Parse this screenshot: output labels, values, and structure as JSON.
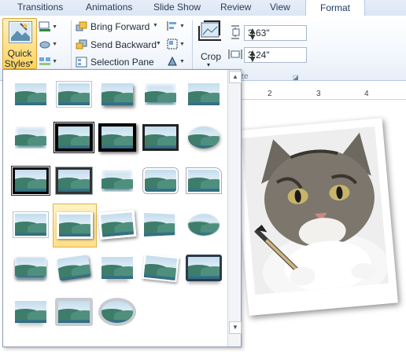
{
  "tabs": [
    {
      "label": "Transitions",
      "active": false
    },
    {
      "label": "Animations",
      "active": false
    },
    {
      "label": "Slide Show",
      "active": false
    },
    {
      "label": "Review",
      "active": false
    },
    {
      "label": "View",
      "active": false
    },
    {
      "label": "Format",
      "active": true
    }
  ],
  "ribbon": {
    "quick_styles": {
      "line1": "Quick",
      "line2": "Styles",
      "dropdown": "▾"
    },
    "arrange": {
      "bring_forward": "Bring Forward",
      "send_backward": "Send Backward",
      "selection_pane": "Selection Pane"
    },
    "crop": {
      "label": "Crop",
      "dropdown": "▾"
    },
    "size": {
      "height": "3.63\"",
      "width": "3.24\"",
      "group_label_fragment": "ze"
    }
  },
  "ruler": {
    "labels": [
      "2",
      "3",
      "4"
    ]
  },
  "gallery": {
    "icon": "picture-thumbnail-icon",
    "selected_index": 16,
    "styles": [
      "plain",
      "white",
      "shadow",
      "soft",
      "reflect-soft",
      "soft",
      "thickblack",
      "blackshadow",
      "darkframe",
      "oval",
      "blackdbl",
      "metal",
      "soft",
      "round",
      "snip",
      "white",
      "polaroid",
      "rotwhite",
      "persp",
      "feather",
      "bevel",
      "tilt",
      "reflect",
      "tiltwhite",
      "darkbevel",
      "lightreflect",
      "grayframe",
      "ovalframe"
    ]
  },
  "colors": {
    "accent": "#ffd35c",
    "tab_bar": "#dbe6f4",
    "frame": "#8a9bb3"
  }
}
